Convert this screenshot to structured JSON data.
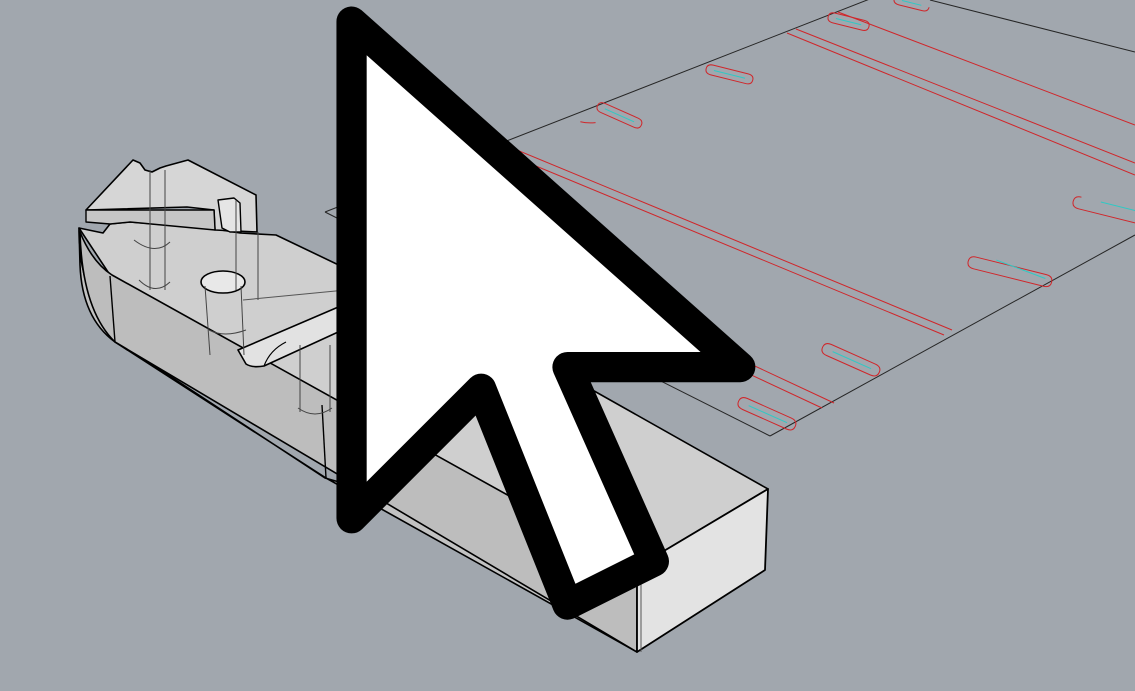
{
  "app": {
    "view": "perspective-viewport",
    "background_color": "#a1a7ae"
  },
  "colors": {
    "sheet_outline": "#262626",
    "cut_lines": "#d0262a",
    "etch_lines": "#2fc9c4",
    "solid_edge": "#000000",
    "solid_face_light": "#dcdcdc",
    "solid_face_mid": "#c8c8c8"
  },
  "objects": [
    {
      "name": "flat-pattern-sheet",
      "type": "outline-drawing"
    },
    {
      "name": "base-part-solid",
      "type": "ghosted-solid"
    }
  ],
  "cursor": {
    "icon": "arrow-pointer-icon"
  }
}
